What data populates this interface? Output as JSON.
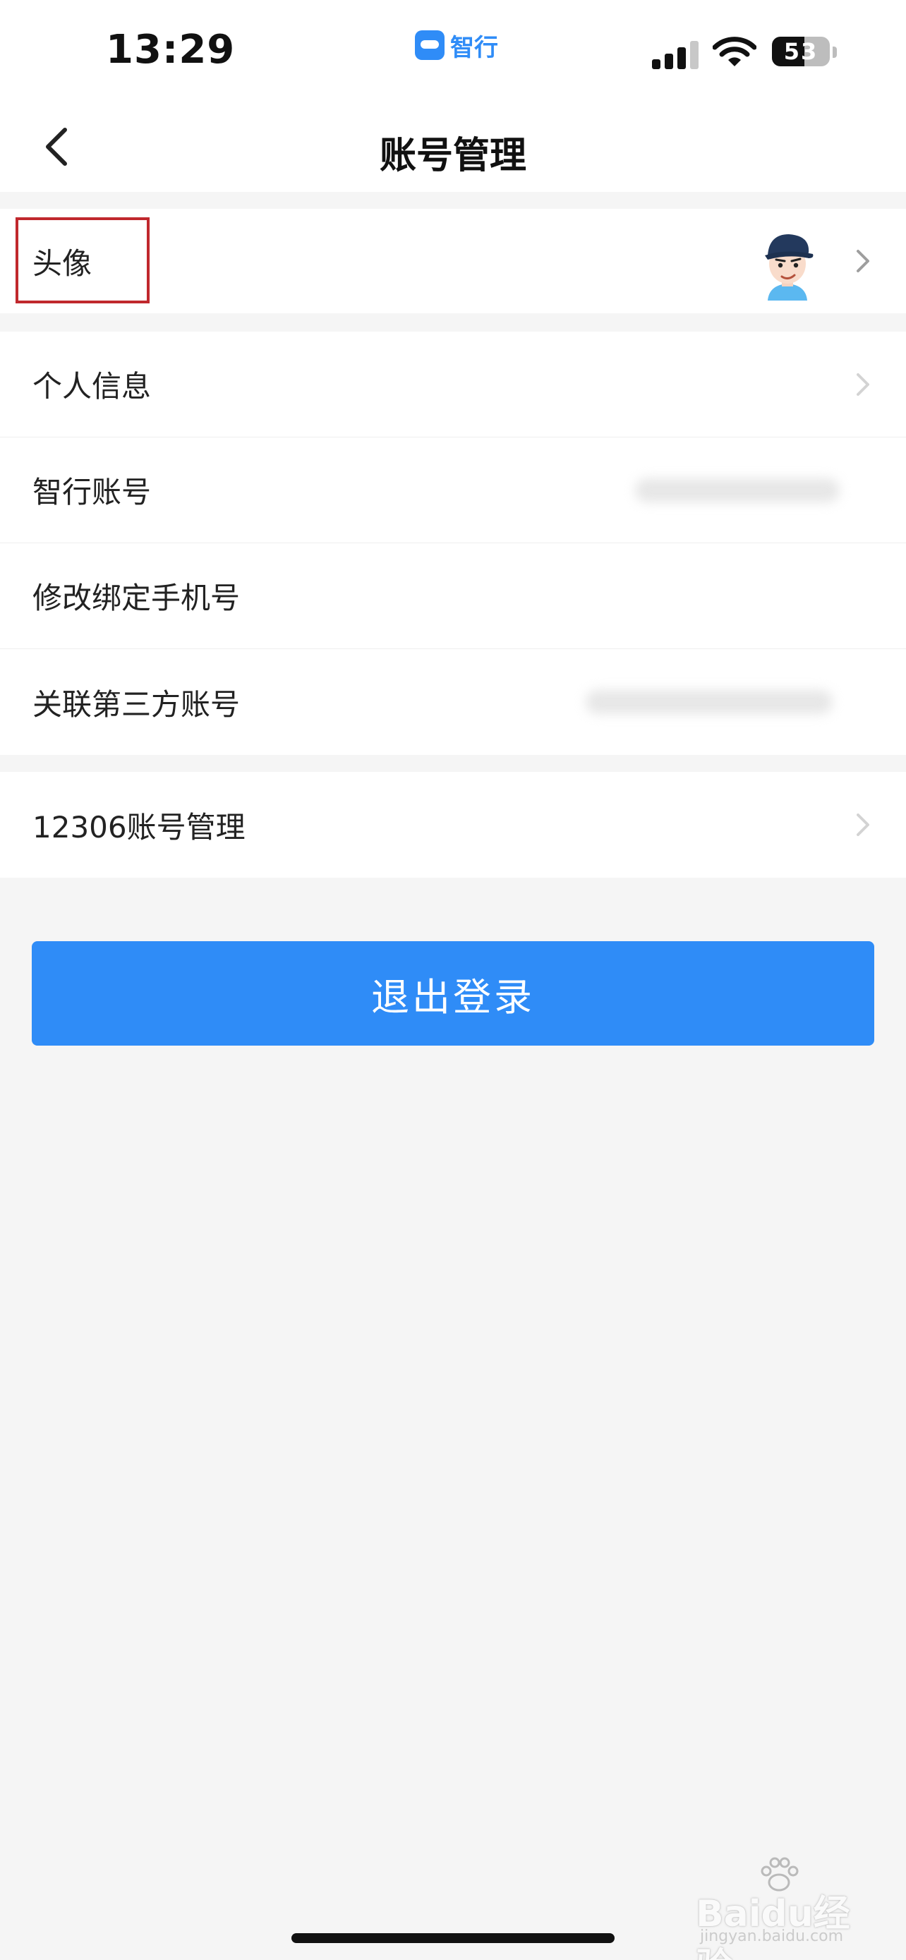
{
  "status_bar": {
    "time": "13:29",
    "app_name": "智行",
    "battery_level": "53",
    "signal_bars": 3,
    "signal_icon": "cellular-signal-icon",
    "wifi_icon": "wifi-icon",
    "battery_icon": "battery-icon"
  },
  "nav": {
    "title": "账号管理",
    "back_icon": "chevron-left-icon"
  },
  "profile_group": {
    "avatar_label": "头像",
    "avatar_icon": "cartoon-avatar-icon",
    "highlight_color": "#c0282d"
  },
  "account_group": {
    "items": [
      {
        "label": "个人信息",
        "has_arrow": true
      },
      {
        "label": "智行账号",
        "has_arrow": false
      },
      {
        "label": "修改绑定手机号",
        "has_arrow": false
      },
      {
        "label": "关联第三方账号",
        "has_arrow": false
      }
    ]
  },
  "railway_group": {
    "label": "12306账号管理",
    "has_arrow": true
  },
  "logout": {
    "label": "退出登录"
  },
  "watermark": {
    "text": "Baidu经验",
    "url": "jingyan.baidu.com"
  },
  "colors": {
    "accent": "#2f8cf7",
    "background": "#f5f5f5",
    "surface": "#ffffff",
    "text": "#222222"
  }
}
